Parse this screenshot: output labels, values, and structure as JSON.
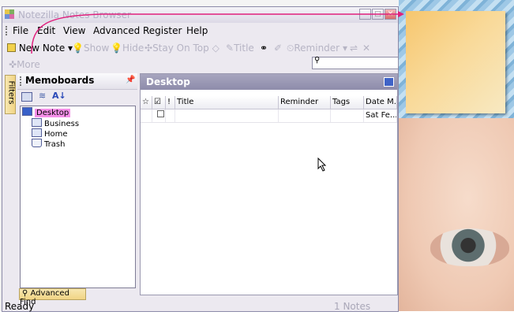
{
  "window": {
    "title": "Notezilla Notes Browser"
  },
  "menu": [
    "File",
    "Edit",
    "View",
    "Advanced",
    "Register",
    "Help"
  ],
  "toolbar": {
    "new_note": "New Note",
    "show": "Show",
    "hide": "Hide",
    "stay_on_top": "Stay On Top",
    "title": "Title",
    "reminder": "Reminder",
    "more": "More"
  },
  "left_panel": {
    "title": "Memoboards",
    "filters_tab": "Filters",
    "tree": [
      "Desktop",
      "Business",
      "Home",
      "Trash"
    ],
    "advanced_find": "Advanced Find"
  },
  "right_panel": {
    "title": "Desktop",
    "columns": [
      "Title",
      "Reminder",
      "Tags",
      "Date M..."
    ],
    "rows": [
      {
        "title": "",
        "reminder": "",
        "tags": "",
        "date": "Sat Fe..."
      }
    ]
  },
  "status": {
    "left": "Ready",
    "right": "1 Notes"
  },
  "colors": {
    "sticky": "#f8d58d",
    "arrow": "#e0207d",
    "selection": "#f58fe8"
  }
}
